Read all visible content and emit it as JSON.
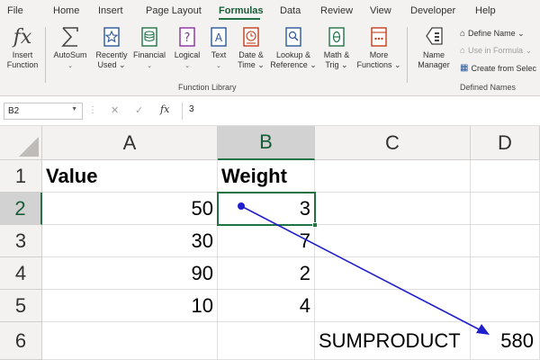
{
  "ribbon_tabs": [
    {
      "label": "File"
    },
    {
      "label": "Home"
    },
    {
      "label": "Insert"
    },
    {
      "label": "Page Layout"
    },
    {
      "label": "Formulas",
      "active": true
    },
    {
      "label": "Data"
    },
    {
      "label": "Review"
    },
    {
      "label": "View"
    },
    {
      "label": "Developer"
    },
    {
      "label": "Help"
    }
  ],
  "function_library": {
    "group_label": "Function Library",
    "buttons": [
      {
        "line1": "Insert",
        "line2": "Function",
        "icon": "fx-icon"
      },
      {
        "line1": "AutoSum",
        "line2": "⌄",
        "icon": "sigma-icon"
      },
      {
        "line1": "Recently",
        "line2": "Used ⌄",
        "icon": "star-book-icon"
      },
      {
        "line1": "Financial",
        "line2": "⌄",
        "icon": "database-book-icon"
      },
      {
        "line1": "Logical",
        "line2": "⌄",
        "icon": "question-book-icon"
      },
      {
        "line1": "Text",
        "line2": "⌄",
        "icon": "text-book-icon"
      },
      {
        "line1": "Date &",
        "line2": "Time ⌄",
        "icon": "clock-book-icon"
      },
      {
        "line1": "Lookup &",
        "line2": "Reference ⌄",
        "icon": "magnifier-book-icon"
      },
      {
        "line1": "Math &",
        "line2": "Trig ⌄",
        "icon": "theta-book-icon"
      },
      {
        "line1": "More",
        "line2": "Functions ⌄",
        "icon": "more-book-icon"
      }
    ]
  },
  "defined_names": {
    "group_label": "Defined Names",
    "name_manager": {
      "line1": "Name",
      "line2": "Manager",
      "icon": "tag-icon"
    },
    "define_name": "Define Name ⌄",
    "use_in_formula": "Use in Formula ⌄",
    "create_from_selection": "Create from Selec"
  },
  "formula_bar": {
    "name_box": "B2",
    "dots": "⋮",
    "fx": "fx",
    "content": "3"
  },
  "columns": [
    "A",
    "B",
    "C",
    "D"
  ],
  "rows": [
    "1",
    "2",
    "3",
    "4",
    "5",
    "6"
  ],
  "cells": {
    "A1": "Value",
    "B1": "Weight",
    "A2": "50",
    "B2": "3",
    "A3": "30",
    "B3": "7",
    "A4": "90",
    "B4": "2",
    "A5": "10",
    "B5": "4",
    "C6": "SUMPRODUCT",
    "D6": "580"
  },
  "active_cell": "B2",
  "colors": {
    "accent_green": "#217346",
    "tracer_arrow": "#1f1fcc"
  }
}
